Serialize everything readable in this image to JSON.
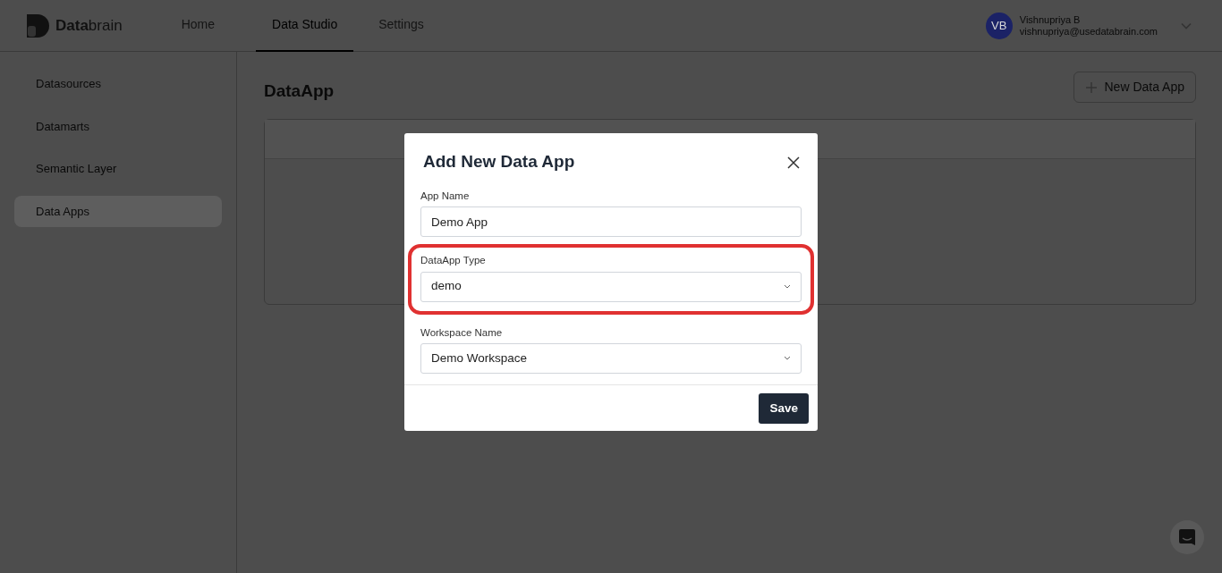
{
  "brand": {
    "name": "**Data**brain"
  },
  "nav_tabs": [
    {
      "label": "Home",
      "selected": false
    },
    {
      "label": "Data Studio",
      "selected": true
    },
    {
      "label": "Settings",
      "selected": false
    }
  ],
  "user": {
    "initials": "VB",
    "name": "Vishnupriya B",
    "email": "vishnupriya@usedatabrain.com"
  },
  "sidebar": {
    "items": [
      {
        "label": "Datasources",
        "selected": false
      },
      {
        "label": "Datamarts",
        "selected": false
      },
      {
        "label": "Semantic Layer",
        "selected": false
      },
      {
        "label": "Data Apps",
        "selected": true
      }
    ]
  },
  "page": {
    "title": "DataApp",
    "new_button": "New Data App"
  },
  "modal": {
    "title": "Add New Data App",
    "fields": [
      {
        "kind": "text",
        "label": "App Name",
        "value": "Demo App",
        "highlighted": false
      },
      {
        "kind": "select",
        "label": "DataApp Type",
        "value": "demo",
        "highlighted": true
      },
      {
        "kind": "select",
        "label": "Workspace Name",
        "value": "Demo Workspace",
        "highlighted": false
      }
    ],
    "save_button": "Save"
  }
}
